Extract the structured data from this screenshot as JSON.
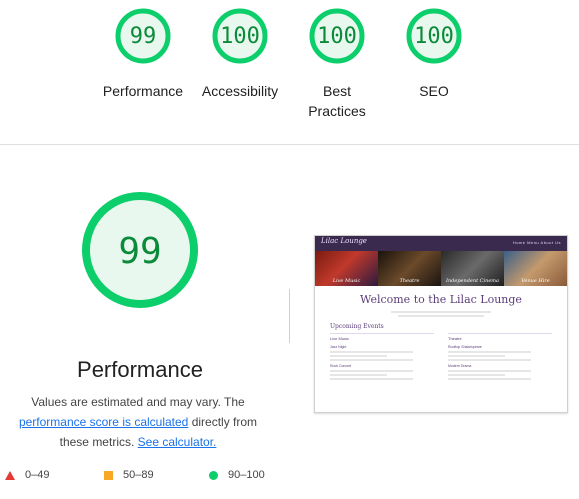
{
  "summary": {
    "gauges": [
      {
        "score": "99",
        "label": "Performance"
      },
      {
        "score": "100",
        "label": "Accessibility"
      },
      {
        "score": "100",
        "label": "Best Practices"
      },
      {
        "score": "100",
        "label": "SEO"
      }
    ]
  },
  "detail": {
    "score": "99",
    "title": "Performance",
    "desc_prefix": "Values are estimated and may vary. The ",
    "desc_link": "performance score is calculated",
    "desc_middle": " directly from these metrics. ",
    "calc_link": "See calculator."
  },
  "legend": [
    {
      "range": "0–49",
      "color": "#e53935",
      "shape": "triangle"
    },
    {
      "range": "50–89",
      "color": "#f9a825",
      "shape": "square"
    },
    {
      "range": "90–100",
      "color": "#0cce6b",
      "shape": "circle"
    }
  ],
  "colors": {
    "pass_ring": "#0cce6b",
    "pass_fill": "#e8f8ee",
    "pass_text": "#0b8a3a",
    "link": "#1a73e8"
  },
  "thumbnail": {
    "brand": "Lilac Lounge",
    "nav_links": "Home  Menu  About Us",
    "hero_labels": [
      "Live Music",
      "Theatre",
      "Independent Cinema",
      "Venue Hire"
    ],
    "heading": "Welcome to the Lilac Lounge",
    "section": "Upcoming Events",
    "col_left": "Live Music",
    "col_right": "Theatre",
    "events_left": [
      "Jazz Night",
      "Rock Concert"
    ],
    "events_right": [
      "Rooftop Shakespeare",
      "Modern Drama"
    ]
  }
}
